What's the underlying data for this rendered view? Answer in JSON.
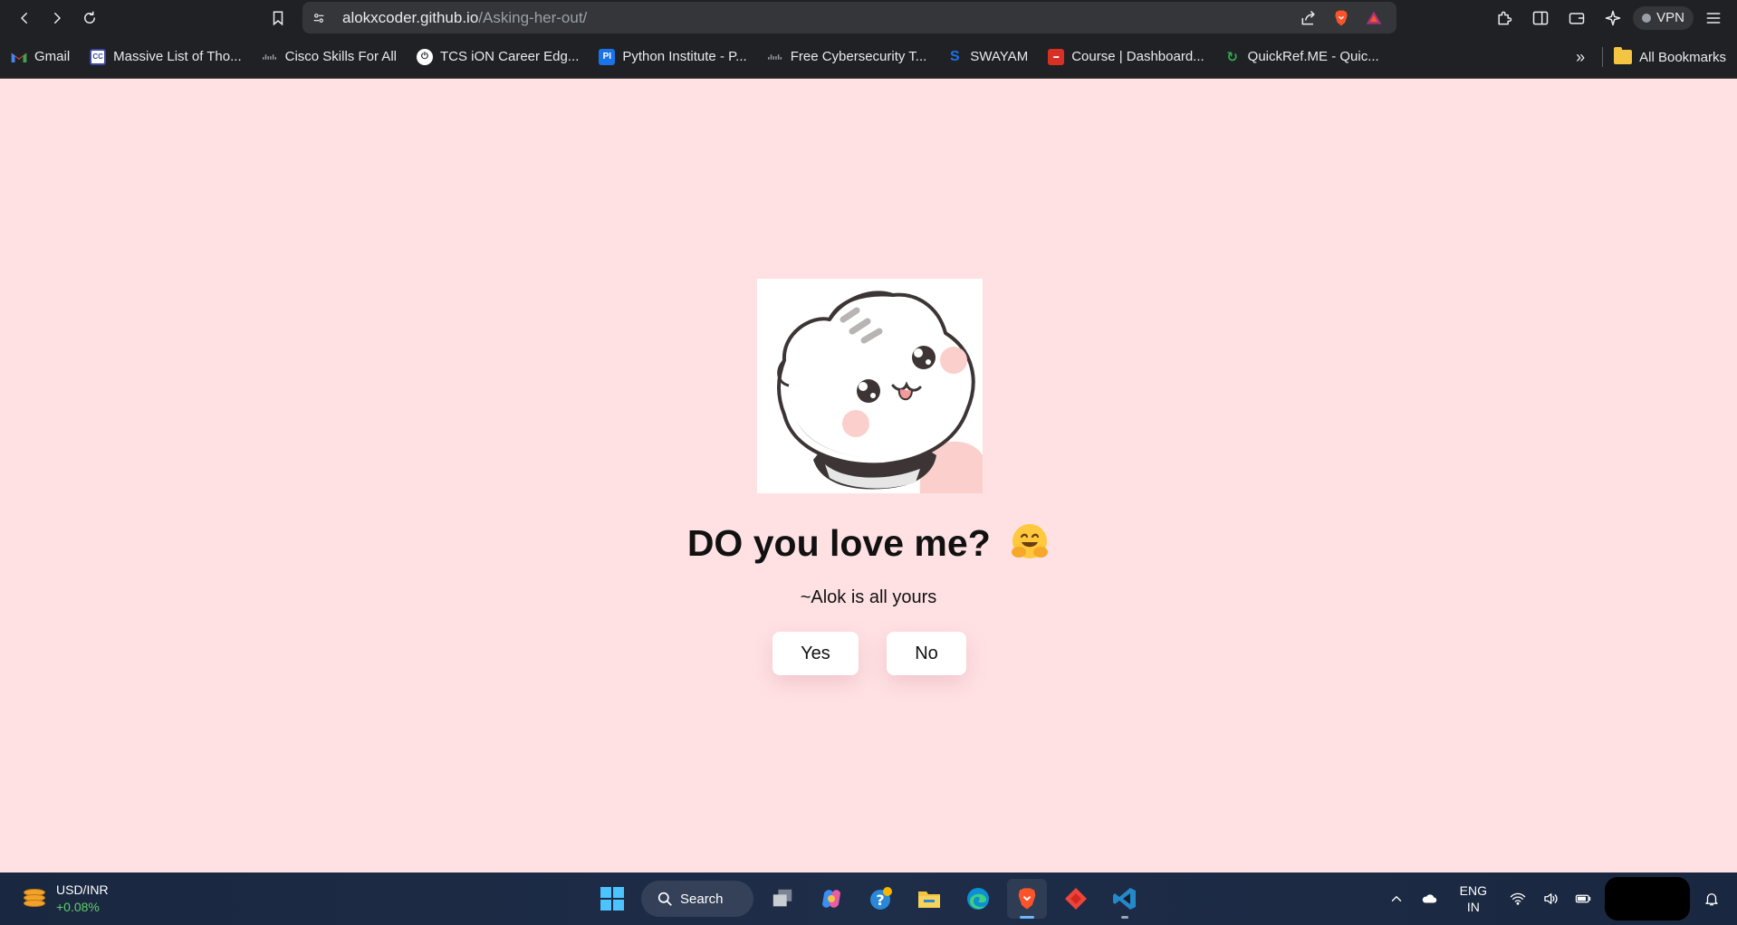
{
  "browser": {
    "url_host": "alokxcoder.github.io",
    "url_path": "/Asking-her-out/",
    "vpn_label": "VPN"
  },
  "bookmarks": {
    "items": [
      {
        "label": "Gmail",
        "icon": "gmail-icon",
        "color": "#ea4335"
      },
      {
        "label": "Massive List of Tho...",
        "icon": "cc-icon",
        "color": "#3c4a9e"
      },
      {
        "label": "Cisco Skills For All",
        "icon": "cisco-icon",
        "color": "#5f6368"
      },
      {
        "label": "TCS iON Career Edg...",
        "icon": "tcs-icon",
        "color": "#202124"
      },
      {
        "label": "Python Institute - P...",
        "icon": "python-institute-icon",
        "color": "#1a73e8"
      },
      {
        "label": "Free Cybersecurity T...",
        "icon": "cisco-icon",
        "color": "#5f6368"
      },
      {
        "label": "SWAYAM",
        "icon": "swayam-icon",
        "color": "#1a73e8"
      },
      {
        "label": "Course | Dashboard...",
        "icon": "course-icon",
        "color": "#d93025"
      },
      {
        "label": "QuickRef.ME - Quic...",
        "icon": "quickref-icon",
        "color": "#34a853"
      }
    ],
    "all_bookmarks_label": "All Bookmarks"
  },
  "page": {
    "title": "DO you love me?",
    "subtitle": "~Alok is all yours",
    "yes_label": "Yes",
    "no_label": "No",
    "background": "#ffe1e4"
  },
  "taskbar": {
    "widget_title": "USD/INR",
    "widget_change": "+0.08%",
    "search_label": "Search",
    "lang_top": "ENG",
    "lang_bottom": "IN"
  }
}
